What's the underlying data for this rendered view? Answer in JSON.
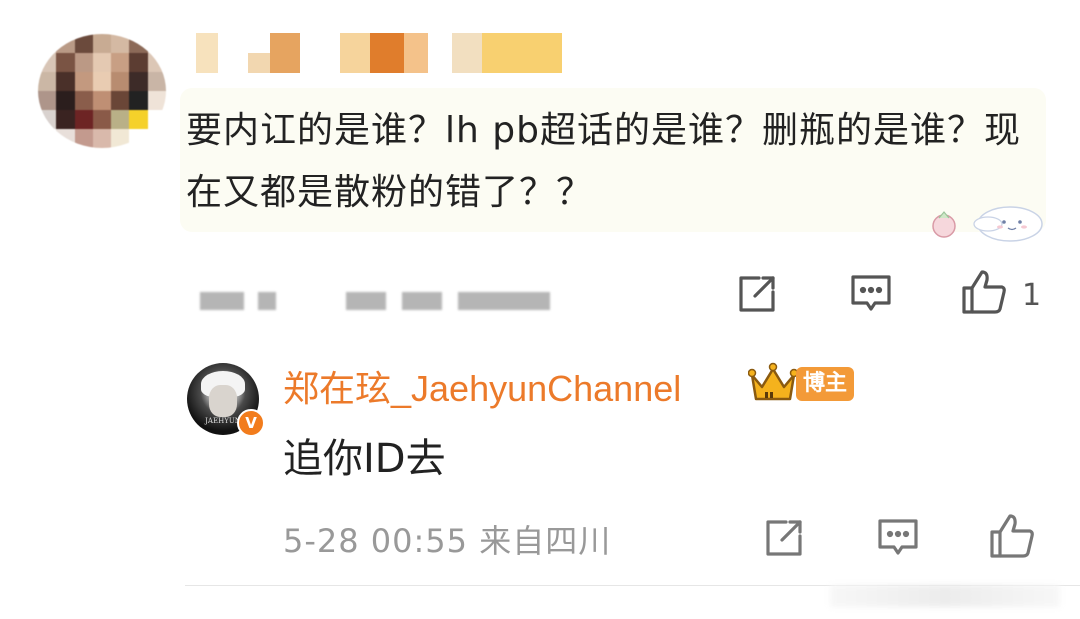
{
  "comment": {
    "text": "要内讧的是谁？lh pb超话的是谁？删瓶的是谁？现在又都是散粉的错了？？",
    "like_count": "1"
  },
  "reply": {
    "author": "郑在玹_JaehyunChannel",
    "avatar_caption": "JAEHYUN",
    "verified_mark": "V",
    "host_badge": "博主",
    "text": "追你ID去",
    "time_location": "5-28 00:55 来自四川"
  },
  "colors": {
    "accent_orange": "#ec7a2a",
    "badge_orange": "#f39a38",
    "bubble_bg": "#fcfcf3",
    "icon_gray": "#555555"
  },
  "icons": [
    "forward-icon",
    "comment-icon",
    "like-icon",
    "crown-icon",
    "sticker-icon"
  ]
}
